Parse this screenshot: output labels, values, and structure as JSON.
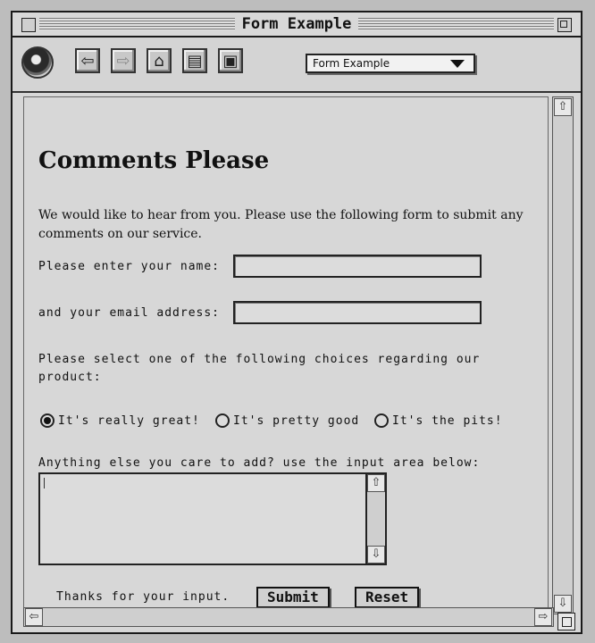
{
  "window": {
    "title": "Form Example"
  },
  "toolbar": {
    "back_icon": "arrow-left-icon",
    "forward_icon": "arrow-right-icon",
    "home_icon": "home-icon",
    "reload_icon": "document-icon",
    "save_icon": "floppy-disk-icon",
    "location_select": {
      "selected": "Form Example"
    }
  },
  "page": {
    "heading": "Comments Please",
    "intro": "We would like to hear from you. Please use the following form to submit any comments on our service.",
    "name_label": "Please enter your name:",
    "email_label": "and your email address:",
    "choice_prompt": "Please select one of the following choices regarding our product:",
    "choices": [
      {
        "label": "It's really great!",
        "selected": true
      },
      {
        "label": "It's pretty good",
        "selected": false
      },
      {
        "label": "It's the pits!",
        "selected": false
      }
    ],
    "comments_label": "Anything else you care to add? use the input area below:",
    "thanks": "Thanks for your input.",
    "submit_label": "Submit",
    "reset_label": "Reset"
  },
  "colors": {
    "window_bg": "#d7d7d7",
    "border": "#1a1a1a"
  }
}
